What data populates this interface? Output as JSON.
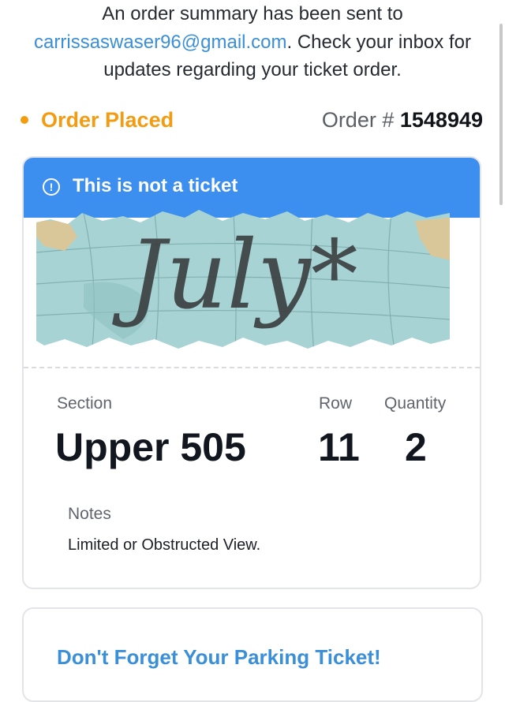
{
  "summary": {
    "line1": "An order summary has been sent to",
    "email": "carrissaswaser96@gmail.com",
    "line2_rest": ". Check your inbox for",
    "line3": "updates regarding your ticket order."
  },
  "order": {
    "status": "Order Placed",
    "status_color": "#f39c12",
    "number_label": "Order #",
    "number": "1548949"
  },
  "ticket_card": {
    "banner_text": "This is not a ticket",
    "banner_color": "#3c8eef",
    "art_text": "July*",
    "section_label": "Section",
    "section_value": "Upper 505",
    "row_label": "Row",
    "row_value": "11",
    "quantity_label": "Quantity",
    "quantity_value": "2",
    "notes_label": "Notes",
    "notes_value": "Limited or Obstructed View."
  },
  "parking_card": {
    "title": "Don't Forget Your Parking Ticket!"
  },
  "accent_color": "#3a8fd8"
}
